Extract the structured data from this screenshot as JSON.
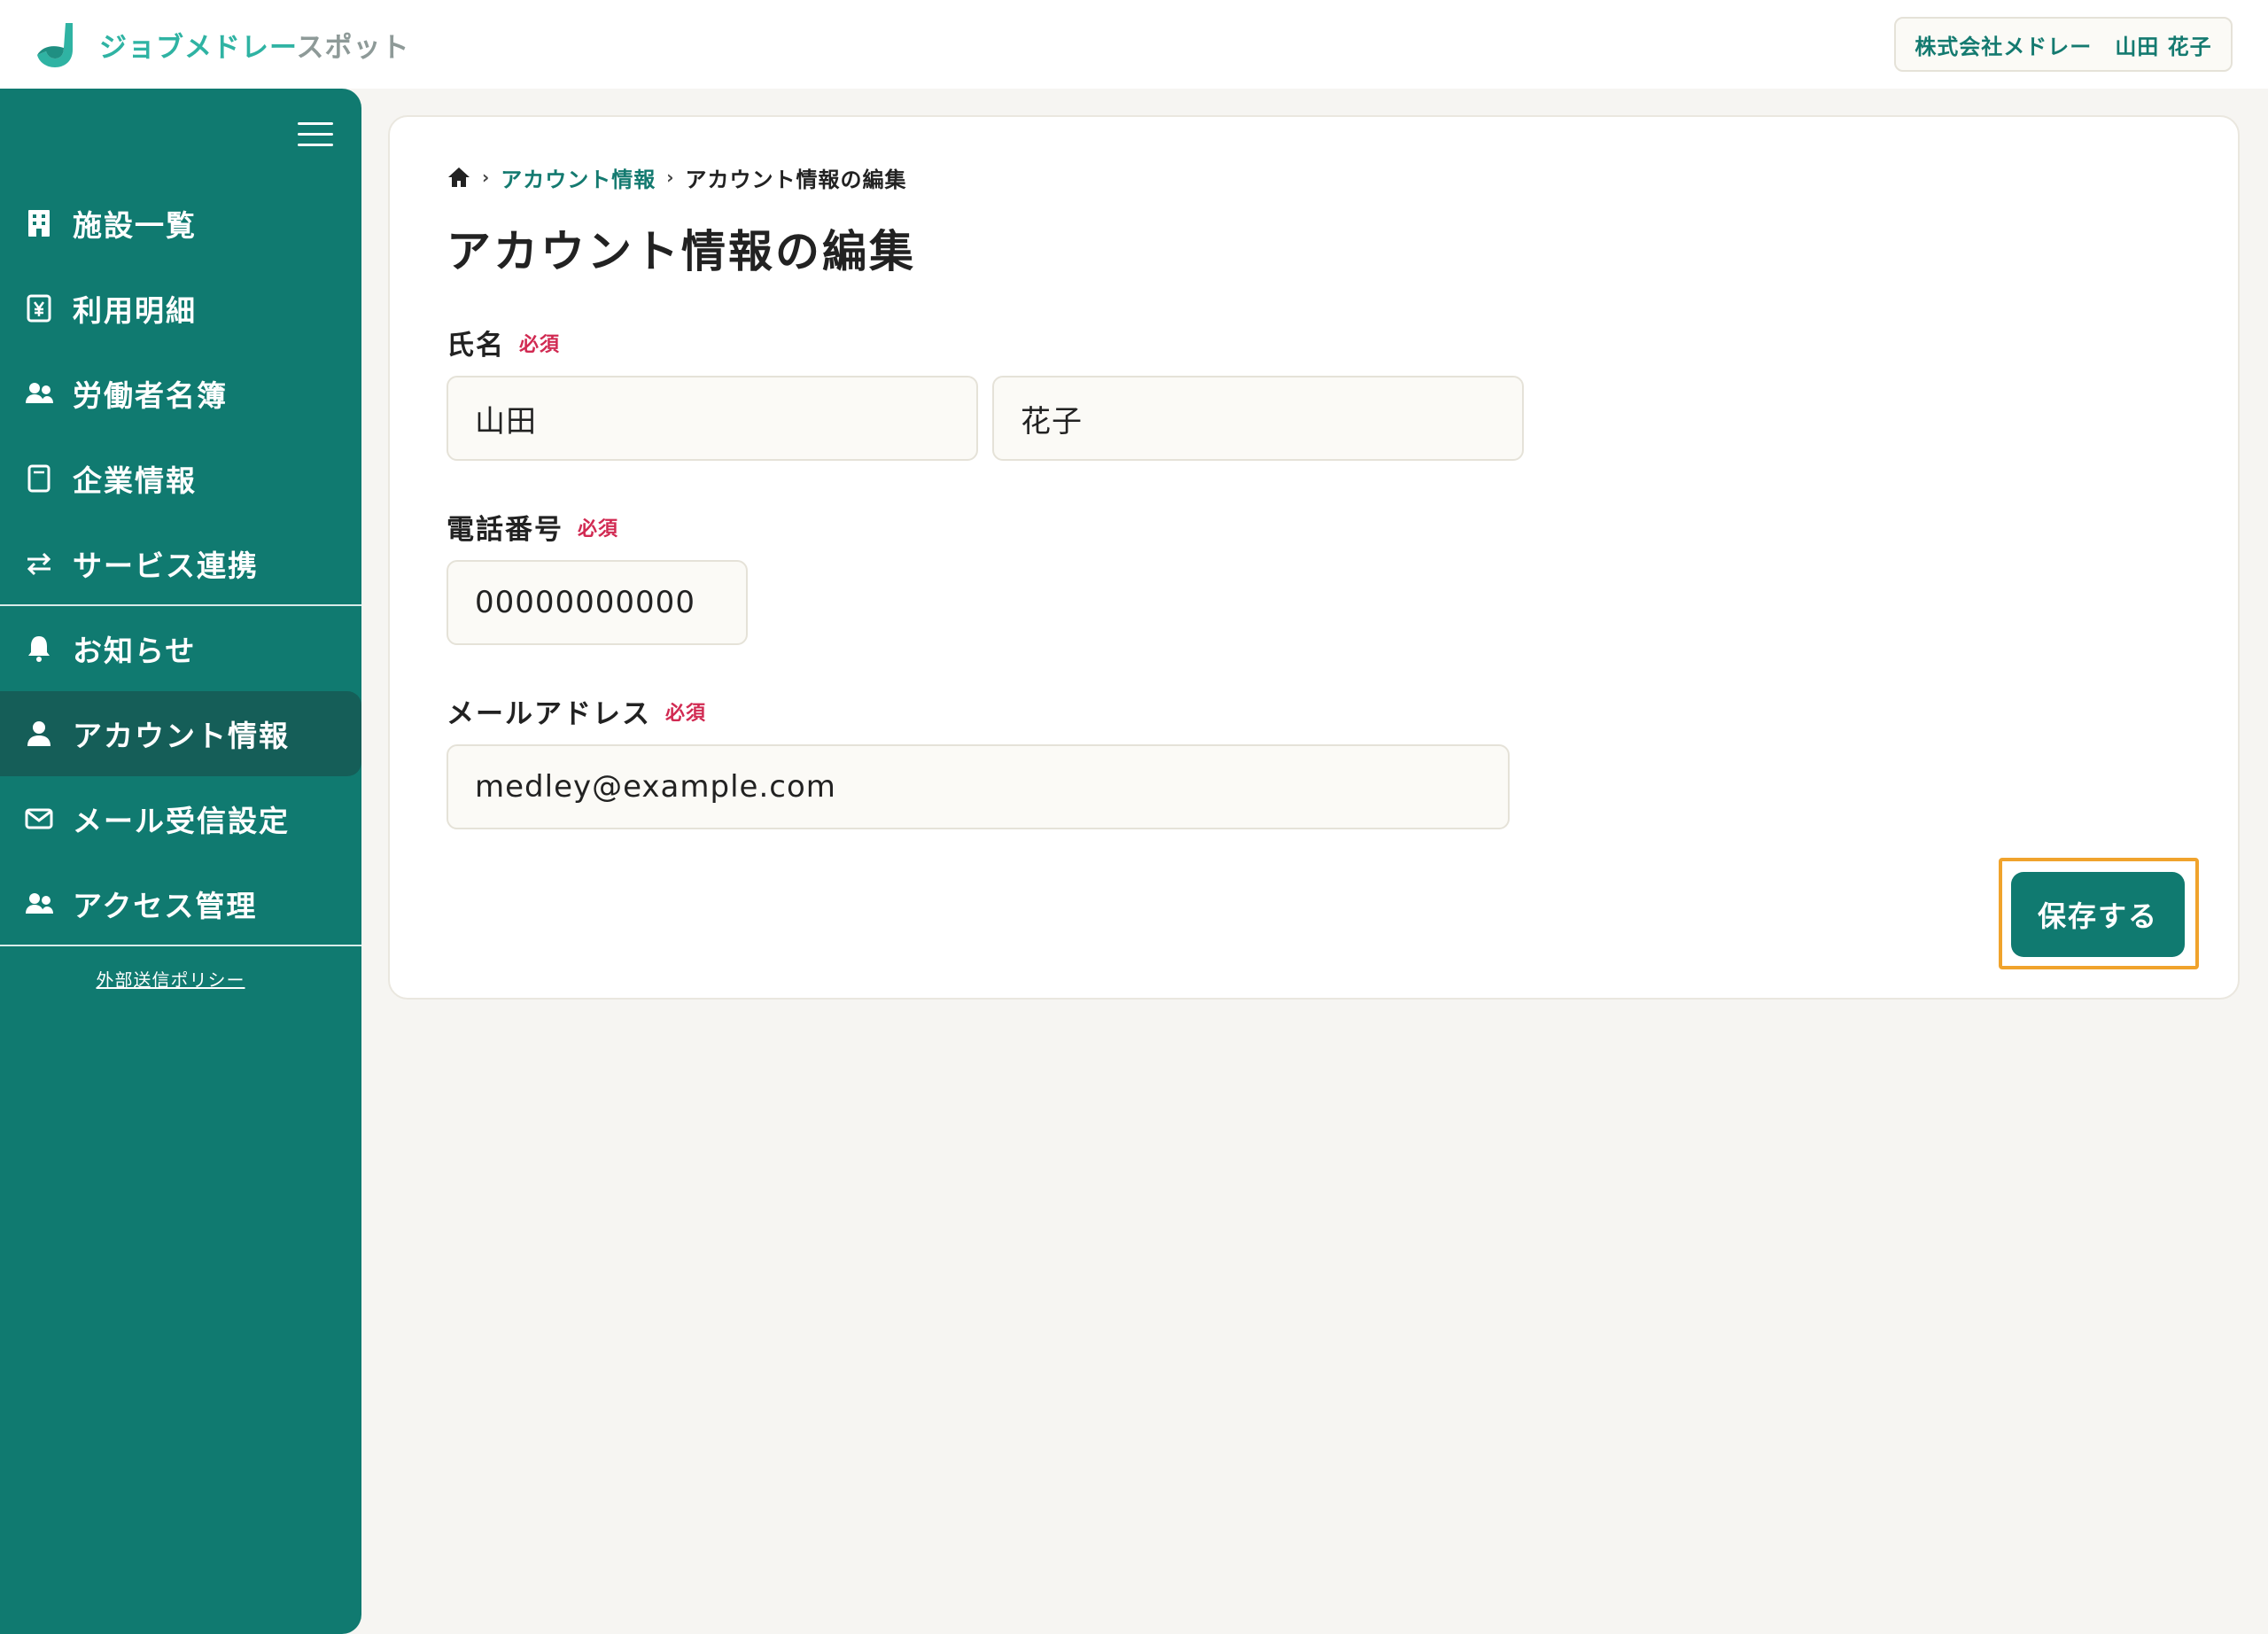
{
  "app": {
    "logo_text_main": "ジョブメドレー",
    "logo_text_sub": "スポット",
    "brand_color": "#2fb3a3",
    "primary_color": "#107a70"
  },
  "header": {
    "company": "株式会社メドレー",
    "user": "山田 花子"
  },
  "sidebar": {
    "menu_icon": "hamburger-icon",
    "items": [
      {
        "label": "施設一覧",
        "icon": "building-icon"
      },
      {
        "label": "利用明細",
        "icon": "yen-receipt-icon"
      },
      {
        "label": "労働者名簿",
        "icon": "users-icon"
      },
      {
        "label": "企業情報",
        "icon": "document-icon"
      },
      {
        "label": "サービス連携",
        "icon": "swap-arrows-icon"
      },
      {
        "label": "お知らせ",
        "icon": "bell-icon"
      },
      {
        "label": "アカウント情報",
        "icon": "person-icon"
      },
      {
        "label": "メール受信設定",
        "icon": "mail-icon"
      },
      {
        "label": "アクセス管理",
        "icon": "users-icon"
      }
    ],
    "active_item": "アカウント情報",
    "policy_link": "外部送信ポリシー"
  },
  "breadcrumb": {
    "home_icon": "home-icon",
    "parent": "アカウント情報",
    "current": "アカウント情報の編集"
  },
  "page": {
    "title": "アカウント情報の編集"
  },
  "form": {
    "required_label": "必須",
    "name": {
      "label": "氏名",
      "last_name": "山田",
      "first_name": "花子"
    },
    "phone": {
      "label": "電話番号",
      "value": "00000000000"
    },
    "email": {
      "label": "メールアドレス",
      "value": "medley@example.com"
    },
    "save_label": "保存する"
  }
}
